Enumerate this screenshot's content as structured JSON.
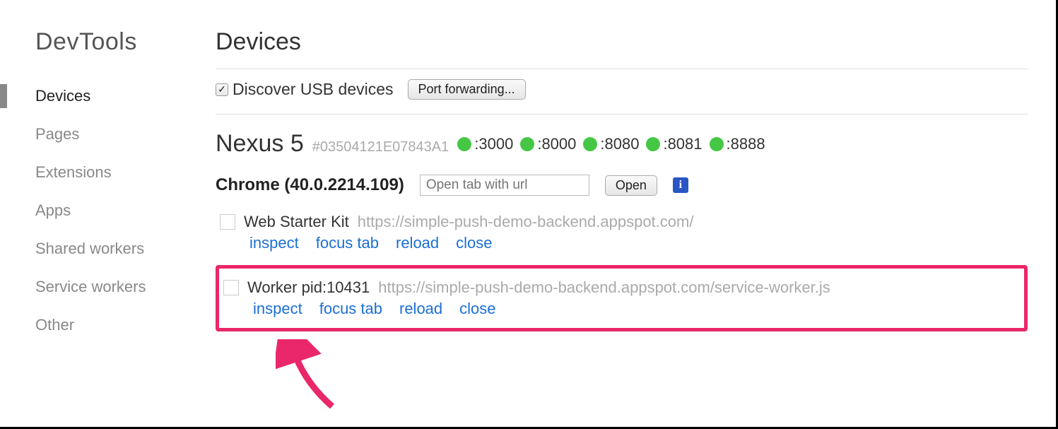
{
  "sidebar": {
    "title": "DevTools",
    "items": [
      "Devices",
      "Pages",
      "Extensions",
      "Apps",
      "Shared workers",
      "Service workers",
      "Other"
    ],
    "activeIndex": 0
  },
  "main": {
    "title": "Devices",
    "discoverLabel": "Discover USB devices",
    "discoverChecked": true,
    "portForwardingLabel": "Port forwarding...",
    "device": {
      "name": "Nexus 5",
      "id": "#03504121E07843A1",
      "ports": [
        ":3000",
        ":8000",
        ":8080",
        ":8081",
        ":8888"
      ]
    },
    "browser": {
      "label": "Chrome (40.0.2214.109)",
      "placeholder": "Open tab with url",
      "openLabel": "Open"
    },
    "targets": [
      {
        "title": "Web Starter Kit",
        "url": "https://simple-push-demo-backend.appspot.com/",
        "actions": [
          "inspect",
          "focus tab",
          "reload",
          "close"
        ],
        "highlight": false
      },
      {
        "title": "Worker pid:10431",
        "url": "https://simple-push-demo-backend.appspot.com/service-worker.js",
        "actions": [
          "inspect",
          "focus tab",
          "reload",
          "close"
        ],
        "highlight": true
      }
    ]
  }
}
